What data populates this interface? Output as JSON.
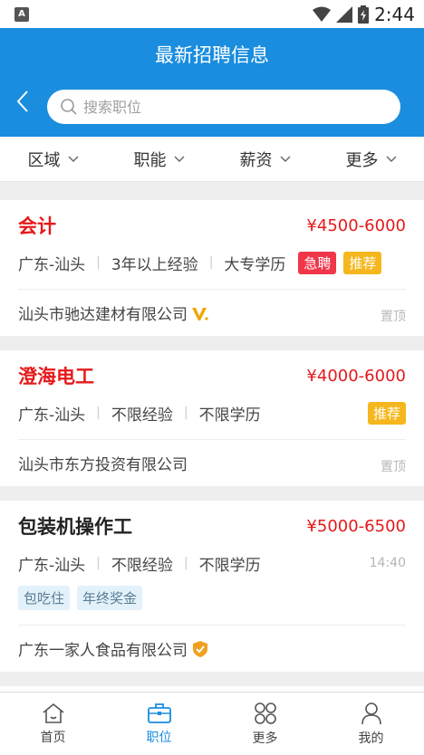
{
  "status_bar": {
    "time": "2:44",
    "app_badge": "A"
  },
  "header": {
    "title": "最新招聘信息"
  },
  "search": {
    "placeholder": "搜索职位"
  },
  "filters": [
    "区域",
    "职能",
    "薪资",
    "更多"
  ],
  "jobs": [
    {
      "title": "会计",
      "salary": "¥4500-6000",
      "location": "广东-汕头",
      "experience": "3年以上经验",
      "education": "大专学历",
      "tags": [
        "急聘",
        "推荐"
      ],
      "company": "汕头市驰达建材有限公司",
      "top_label": "置顶"
    },
    {
      "title": "澄海电工",
      "salary": "¥4000-6000",
      "location": "广东-汕头",
      "experience": "不限经验",
      "education": "不限学历",
      "tags": [
        "推荐"
      ],
      "company": "汕头市东方投资有限公司",
      "top_label": "置顶"
    },
    {
      "title": "包装机操作工",
      "salary": "¥5000-6500",
      "location": "广东-汕头",
      "experience": "不限经验",
      "education": "不限学历",
      "time": "14:40",
      "benefits": [
        "包吃住",
        "年终奖金"
      ],
      "company": "广东一家人食品有限公司"
    }
  ],
  "nav": [
    "首页",
    "职位",
    "更多",
    "我的"
  ],
  "colors": {
    "primary": "#1a8ddf",
    "salary": "#e5191b",
    "urgent": "#f0374a",
    "recommend": "#f5b71d"
  }
}
